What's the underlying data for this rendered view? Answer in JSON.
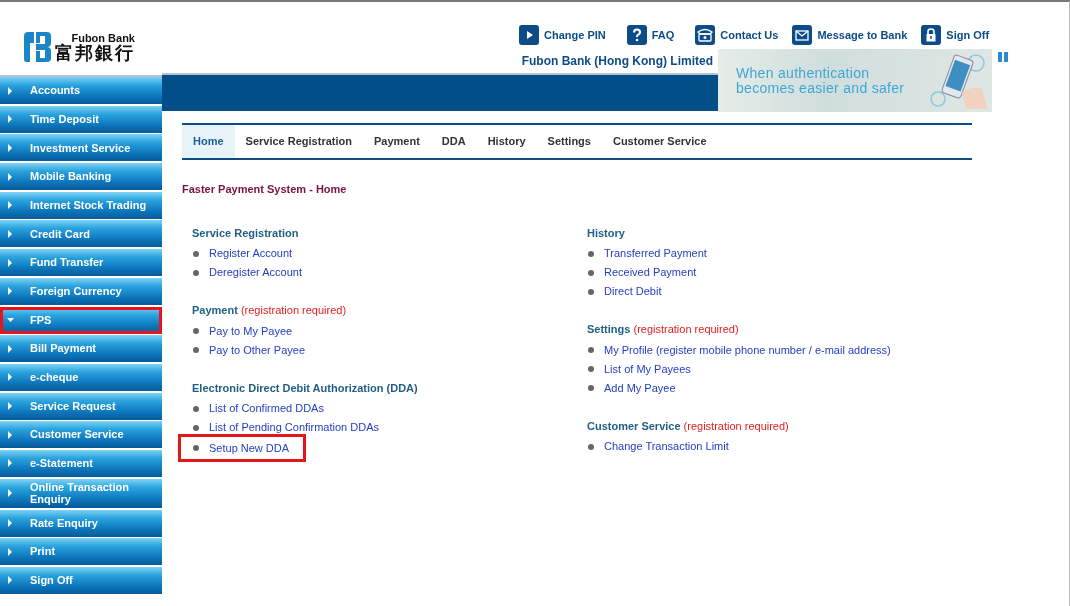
{
  "header": {
    "logo": {
      "english": "Fubon Bank",
      "chinese": "富邦銀行"
    },
    "top_links": [
      {
        "label": "Change PIN",
        "kind": "play"
      },
      {
        "label": "FAQ",
        "kind": "question"
      },
      {
        "label": "Contact Us",
        "kind": "phone"
      },
      {
        "label": "Message to Bank",
        "kind": "mail"
      },
      {
        "label": "Sign Off",
        "kind": "lock"
      }
    ],
    "bank_name": "Fubon Bank (Hong Kong) Limited",
    "banner": {
      "lines": [
        "When authentication",
        "becomes easier and safer"
      ]
    }
  },
  "sidebar": {
    "items": [
      {
        "label": "Accounts",
        "expanded": false,
        "highlighted": false
      },
      {
        "label": "Time Deposit",
        "expanded": false,
        "highlighted": false
      },
      {
        "label": "Investment Service",
        "expanded": false,
        "highlighted": false
      },
      {
        "label": "Mobile Banking",
        "expanded": false,
        "highlighted": false
      },
      {
        "label": "Internet Stock Trading",
        "expanded": false,
        "highlighted": false
      },
      {
        "label": "Credit Card",
        "expanded": false,
        "highlighted": false
      },
      {
        "label": "Fund Transfer",
        "expanded": false,
        "highlighted": false
      },
      {
        "label": "Foreign Currency",
        "expanded": false,
        "highlighted": false
      },
      {
        "label": "FPS",
        "expanded": true,
        "highlighted": true
      },
      {
        "label": "Bill Payment",
        "expanded": false,
        "highlighted": false
      },
      {
        "label": "e-cheque",
        "expanded": false,
        "highlighted": false
      },
      {
        "label": "Service Request",
        "expanded": false,
        "highlighted": false
      },
      {
        "label": "Customer Service",
        "expanded": false,
        "highlighted": false
      },
      {
        "label": "e-Statement",
        "expanded": false,
        "highlighted": false
      },
      {
        "label": "Online Transaction Enquiry",
        "expanded": false,
        "highlighted": false
      },
      {
        "label": "Rate Enquiry",
        "expanded": false,
        "highlighted": false
      },
      {
        "label": "Print",
        "expanded": false,
        "highlighted": false
      },
      {
        "label": "Sign Off",
        "expanded": false,
        "highlighted": false
      }
    ]
  },
  "tabs": [
    {
      "label": "Home",
      "selected": true
    },
    {
      "label": "Service Registration",
      "selected": false
    },
    {
      "label": "Payment",
      "selected": false
    },
    {
      "label": "DDA",
      "selected": false
    },
    {
      "label": "History",
      "selected": false
    },
    {
      "label": "Settings",
      "selected": false
    },
    {
      "label": "Customer Service",
      "selected": false
    }
  ],
  "page_title": "Faster Payment System - Home",
  "columns": [
    [
      {
        "heading": "Service Registration",
        "links": [
          {
            "label": "Register Account",
            "highlighted": false
          },
          {
            "label": "Deregister Account",
            "highlighted": false
          }
        ]
      },
      {
        "heading": "Payment",
        "note": "(registration required)",
        "links": [
          {
            "label": "Pay to My Payee",
            "highlighted": false
          },
          {
            "label": "Pay to Other Payee",
            "highlighted": false
          }
        ]
      },
      {
        "heading": "Electronic Direct Debit Authorization (DDA)",
        "links": [
          {
            "label": "List of Confirmed DDAs",
            "highlighted": false
          },
          {
            "label": "List of Pending Confirmation DDAs",
            "highlighted": false
          },
          {
            "label": "Setup New DDA",
            "highlighted": true
          }
        ]
      }
    ],
    [
      {
        "heading": "History",
        "links": [
          {
            "label": "Transferred Payment",
            "highlighted": false
          },
          {
            "label": "Received Payment",
            "highlighted": false
          },
          {
            "label": "Direct Debit",
            "highlighted": false
          }
        ]
      },
      {
        "heading": "Settings",
        "note": "(registration required)",
        "links": [
          {
            "label": "My Profile (register mobile phone number / e-mail address)",
            "highlighted": false
          },
          {
            "label": "List of My Payees",
            "highlighted": false
          },
          {
            "label": "Add My Payee",
            "highlighted": false
          }
        ]
      },
      {
        "heading": "Customer Service",
        "note": "(registration required)",
        "links": [
          {
            "label": "Change Transaction Limit",
            "highlighted": false
          }
        ]
      }
    ]
  ]
}
